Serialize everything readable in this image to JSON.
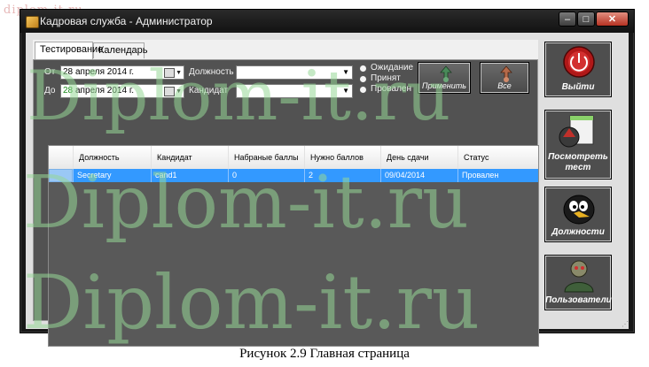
{
  "watermark": {
    "small": "diplom-it.ru",
    "big": "Diplom-it.ru"
  },
  "window": {
    "title": "Кадровая служба - Администратор",
    "controls": {
      "minimize": "–",
      "maximize": "□",
      "close": "✕"
    }
  },
  "tabs": [
    {
      "label": "Тестирование",
      "active": true
    },
    {
      "label": "Календарь",
      "active": false
    }
  ],
  "filters": {
    "from_label": "От",
    "to_label": "До",
    "from_date": {
      "day": "28",
      "rest": "апреля   2014 г."
    },
    "to_date": {
      "day": "28",
      "rest": "апреля   2014 г."
    },
    "position_label": "Должность",
    "candidate_label": "Кандидат",
    "position_value": "",
    "candidate_value": "",
    "status_options": [
      {
        "label": "Ожидание",
        "selected": false
      },
      {
        "label": "Принят",
        "selected": false
      },
      {
        "label": "Провален",
        "selected": false
      }
    ],
    "apply_label": "Применить",
    "all_label": "Все"
  },
  "grid": {
    "columns": [
      "Должность",
      "Кандидат",
      "Набраные баллы",
      "Нужно баллов",
      "День сдачи",
      "Статус"
    ],
    "rows": [
      [
        "Secretary",
        "cand1",
        "0",
        "2",
        "09/04/2014",
        "Провален"
      ]
    ]
  },
  "side_buttons": {
    "exit": "Выйти",
    "view_test": "Посмотреть тест",
    "positions": "Должности",
    "users": "Пользователи"
  },
  "caption": "Рисунок 2.9  Главная страница"
}
